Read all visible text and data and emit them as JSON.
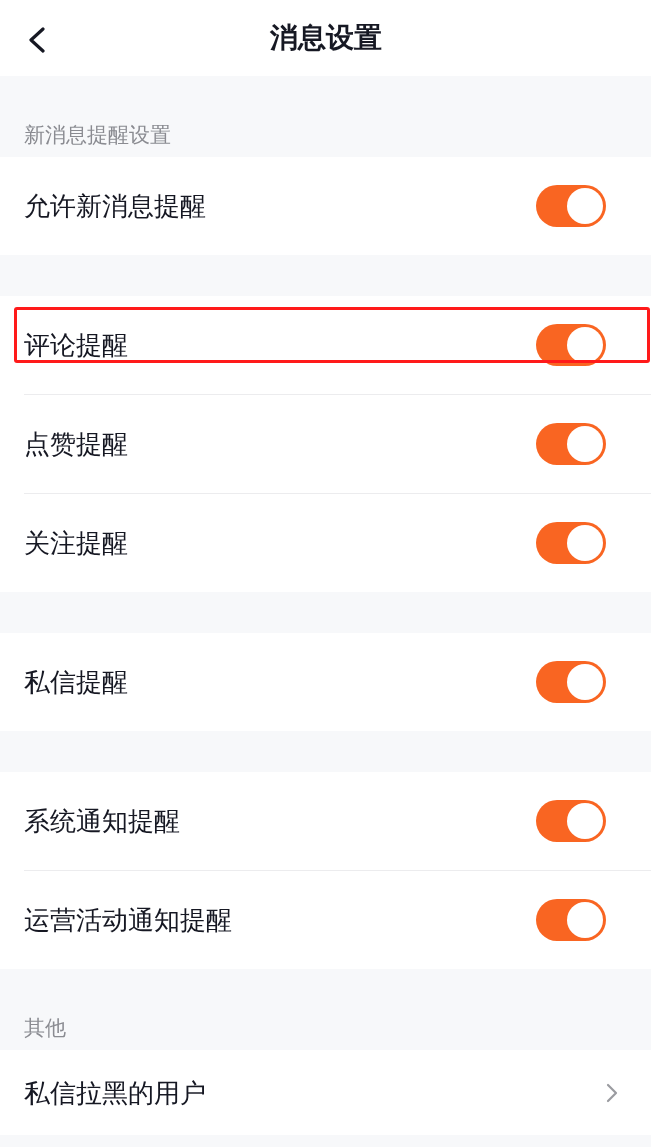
{
  "header": {
    "title": "消息设置"
  },
  "groups": [
    {
      "label": "新消息提醒设置",
      "items": [
        {
          "kind": "toggle",
          "label": "允许新消息提醒",
          "on": true,
          "highlighted": false
        }
      ]
    },
    {
      "items": [
        {
          "kind": "toggle",
          "label": "评论提醒",
          "on": true,
          "highlighted": true
        },
        {
          "kind": "toggle",
          "label": "点赞提醒",
          "on": true,
          "highlighted": false
        },
        {
          "kind": "toggle",
          "label": "关注提醒",
          "on": true,
          "highlighted": false
        }
      ]
    },
    {
      "items": [
        {
          "kind": "toggle",
          "label": "私信提醒",
          "on": true,
          "highlighted": false
        }
      ]
    },
    {
      "items": [
        {
          "kind": "toggle",
          "label": "系统通知提醒",
          "on": true,
          "highlighted": false
        },
        {
          "kind": "toggle",
          "label": "运营活动通知提醒",
          "on": true,
          "highlighted": false
        }
      ]
    },
    {
      "label": "其他",
      "items": [
        {
          "kind": "link",
          "label": "私信拉黑的用户",
          "highlighted": false
        }
      ]
    }
  ]
}
